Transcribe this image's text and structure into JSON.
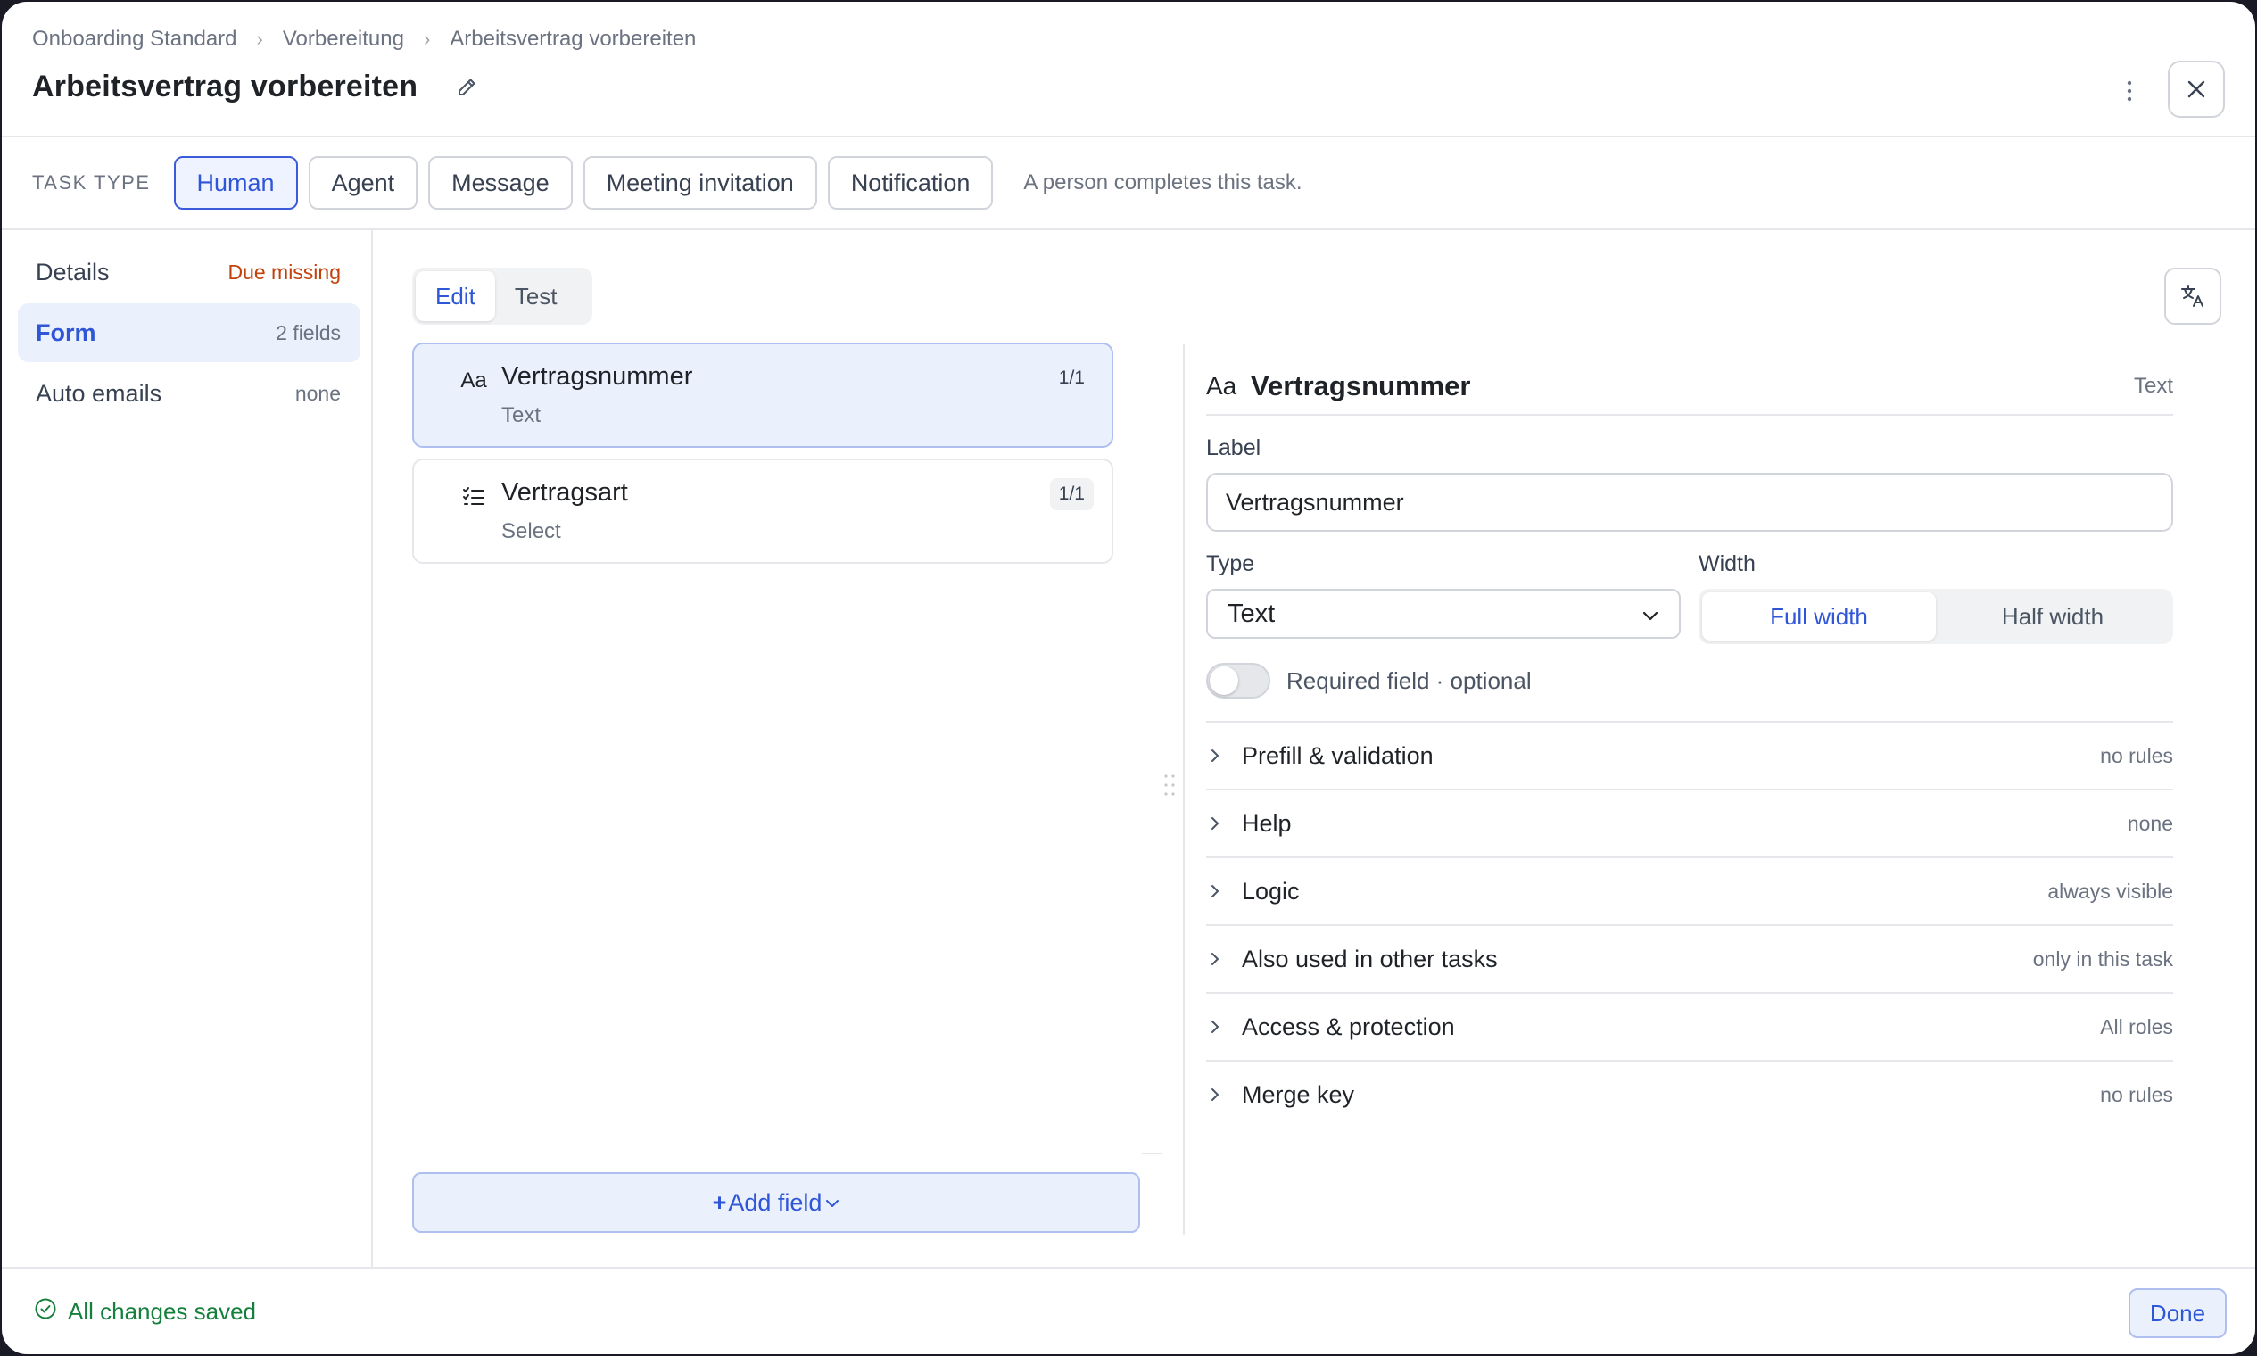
{
  "breadcrumb": [
    "Onboarding Standard",
    "Vorbereitung",
    "Arbeitsvertrag vorbereiten"
  ],
  "title": "Arbeitsvertrag vorbereiten",
  "task_type": {
    "label": "TASK TYPE",
    "options": [
      "Human",
      "Agent",
      "Message",
      "Meeting invitation",
      "Notification"
    ],
    "selected": "Human",
    "description": "A person completes this task."
  },
  "sidebar": {
    "items": [
      {
        "label": "Details",
        "meta": "Due missing"
      },
      {
        "label": "Form",
        "meta": "2 fields"
      },
      {
        "label": "Auto emails",
        "meta": "none"
      }
    ],
    "active": "Form"
  },
  "mode_tabs": {
    "edit": "Edit",
    "test": "Test",
    "selected": "Edit"
  },
  "fields": [
    {
      "icon": "text-type-icon",
      "glyph": "Aa",
      "name": "Vertragsnummer",
      "type": "Text",
      "badge": "1/1"
    },
    {
      "icon": "checklist-type-icon",
      "glyph": "",
      "name": "Vertragsart",
      "type": "Select",
      "badge": "1/1"
    }
  ],
  "add_field": {
    "plus": "+",
    "label": "Add field"
  },
  "editor": {
    "glyph": "Aa",
    "name": "Vertragsnummer",
    "type_badge": "Text",
    "label_heading": "Label",
    "label_value": "Vertragsnummer",
    "type_heading": "Type",
    "type_value": "Text",
    "width_heading": "Width",
    "width_options": [
      "Full width",
      "Half width"
    ],
    "width_selected": "Full width",
    "required_label": "Required field · optional",
    "required_on": false,
    "sections": [
      {
        "label": "Prefill & validation",
        "meta": "no rules"
      },
      {
        "label": "Help",
        "meta": "none"
      },
      {
        "label": "Logic",
        "meta": "always visible"
      },
      {
        "label": "Also used in other tasks",
        "meta": "only in this task"
      },
      {
        "label": "Access & protection",
        "meta": "All roles"
      },
      {
        "label": "Merge key",
        "meta": "no rules"
      }
    ]
  },
  "footer": {
    "status": "All changes saved",
    "done": "Done"
  },
  "colors": {
    "accent": "#2f56d6",
    "accent_bg": "#eaf0fc",
    "warning": "#c2410c",
    "success": "#15803d"
  }
}
